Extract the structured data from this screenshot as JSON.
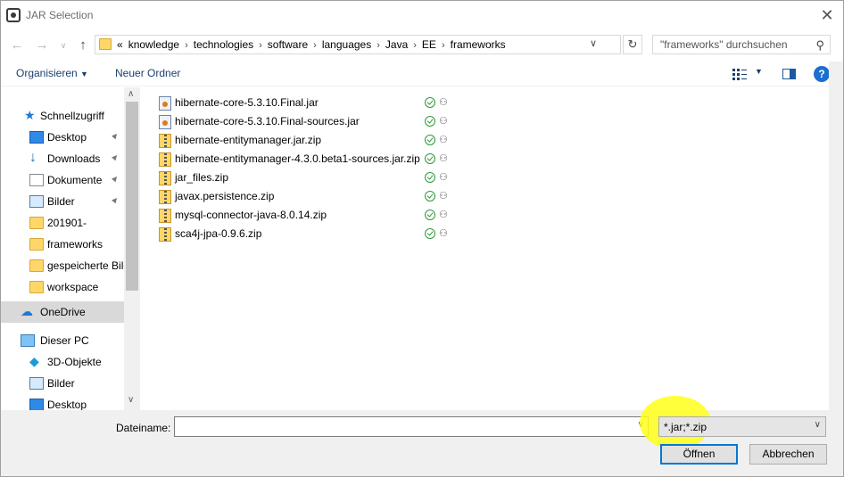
{
  "window": {
    "title": "JAR Selection"
  },
  "address": {
    "crumbs": [
      "knowledge",
      "technologies",
      "software",
      "languages",
      "Java",
      "EE",
      "frameworks"
    ],
    "overflow": "«"
  },
  "search": {
    "placeholder": "\"frameworks\" durchsuchen"
  },
  "toolbar": {
    "organize_label": "Organisieren",
    "new_folder_label": "Neuer Ordner"
  },
  "nav": {
    "quick_access": "Schnellzugriff",
    "items": [
      {
        "label": "Desktop",
        "icon": "desktop-icon",
        "pinned": true
      },
      {
        "label": "Downloads",
        "icon": "download-icon",
        "pinned": true
      },
      {
        "label": "Dokumente",
        "icon": "documents-icon",
        "pinned": true
      },
      {
        "label": "Bilder",
        "icon": "pictures-icon",
        "pinned": true
      },
      {
        "label": "201901-",
        "icon": "folder-icon",
        "pinned": false
      },
      {
        "label": "frameworks",
        "icon": "folder-icon",
        "pinned": false
      },
      {
        "label": "gespeicherte Bilder",
        "icon": "folder-icon",
        "pinned": false
      },
      {
        "label": "workspace",
        "icon": "folder-icon",
        "pinned": false
      }
    ],
    "onedrive": "OneDrive",
    "this_pc": "Dieser PC",
    "pc_items": [
      {
        "label": "3D-Objekte",
        "icon": "3d-objects-icon"
      },
      {
        "label": "Bilder",
        "icon": "pictures-icon"
      },
      {
        "label": "Desktop",
        "icon": "desktop-icon"
      }
    ]
  },
  "files": [
    {
      "name": "hibernate-core-5.3.10.Final.jar",
      "type": "jar"
    },
    {
      "name": "hibernate-core-5.3.10.Final-sources.jar",
      "type": "jar"
    },
    {
      "name": "hibernate-entitymanager.jar.zip",
      "type": "zip"
    },
    {
      "name": "hibernate-entitymanager-4.3.0.beta1-sources.jar.zip",
      "type": "zip"
    },
    {
      "name": "jar_files.zip",
      "type": "zip"
    },
    {
      "name": "javax.persistence.zip",
      "type": "zip"
    },
    {
      "name": "mysql-connector-java-8.0.14.zip",
      "type": "zip"
    },
    {
      "name": "sca4j-jpa-0.9.6.zip",
      "type": "zip"
    }
  ],
  "bottom": {
    "filename_label": "Dateiname:",
    "filename_value": "",
    "filetype_value": "*.jar;*.zip",
    "open_label": "Öffnen",
    "cancel_label": "Abbrechen"
  },
  "colors": {
    "highlight": "#ffff1a",
    "accent": "#0078d7"
  }
}
